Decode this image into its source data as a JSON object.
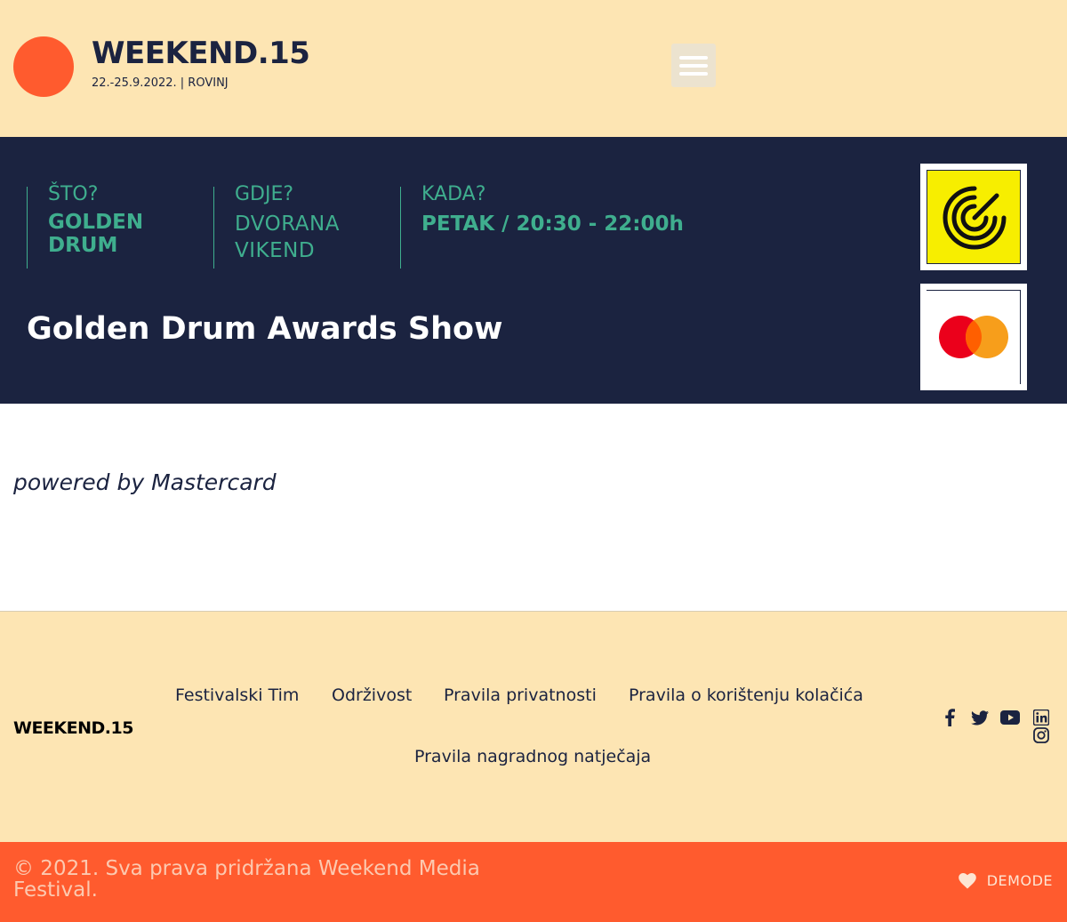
{
  "header": {
    "logo_icon": "orange-circle-logo",
    "brand_title": "WEEKEND.15",
    "brand_subtitle": "22.-25.9.2022. | ROVINJ",
    "menu_icon": "hamburger-menu-icon"
  },
  "event": {
    "what_label": "ŠTO?",
    "what_value": "GOLDEN DRUM",
    "where_label": "GDJE?",
    "where_value": "DVORANA VIKEND",
    "when_label": "KADA?",
    "when_value": "PETAK / 20:30 - 22:00h",
    "title": "Golden Drum Awards Show",
    "sponsors": [
      {
        "name": "golden-drum-logo",
        "icon": "concentric-arcs-icon"
      },
      {
        "name": "mastercard-logo",
        "icon": "mastercard-circles-icon"
      }
    ]
  },
  "content": {
    "powered_by": "powered by Mastercard"
  },
  "footer": {
    "brand": "WEEKEND.15",
    "links": [
      "Festivalski Tim",
      "Održivost",
      "Pravila privatnosti",
      "Pravila o korištenju kolačića",
      "Pravila nagradnog natječaja"
    ],
    "social_icons": [
      "facebook-icon",
      "twitter-icon",
      "youtube-icon",
      "linkedin-icon",
      "instagram-icon"
    ]
  },
  "copyright": {
    "text": "© 2021. Sva prava pridržana Weekend Media Festival.",
    "credit_icon": "heart-icon",
    "credit_label": "DEMODE"
  },
  "colors": {
    "cream": "#fde5b3",
    "navy": "#1b2340",
    "green": "#3fae8e",
    "orange": "#ff5b2e",
    "yellow": "#f7ee00",
    "mastercard_red": "#eb001b",
    "mastercard_orange": "#f79e1b"
  }
}
